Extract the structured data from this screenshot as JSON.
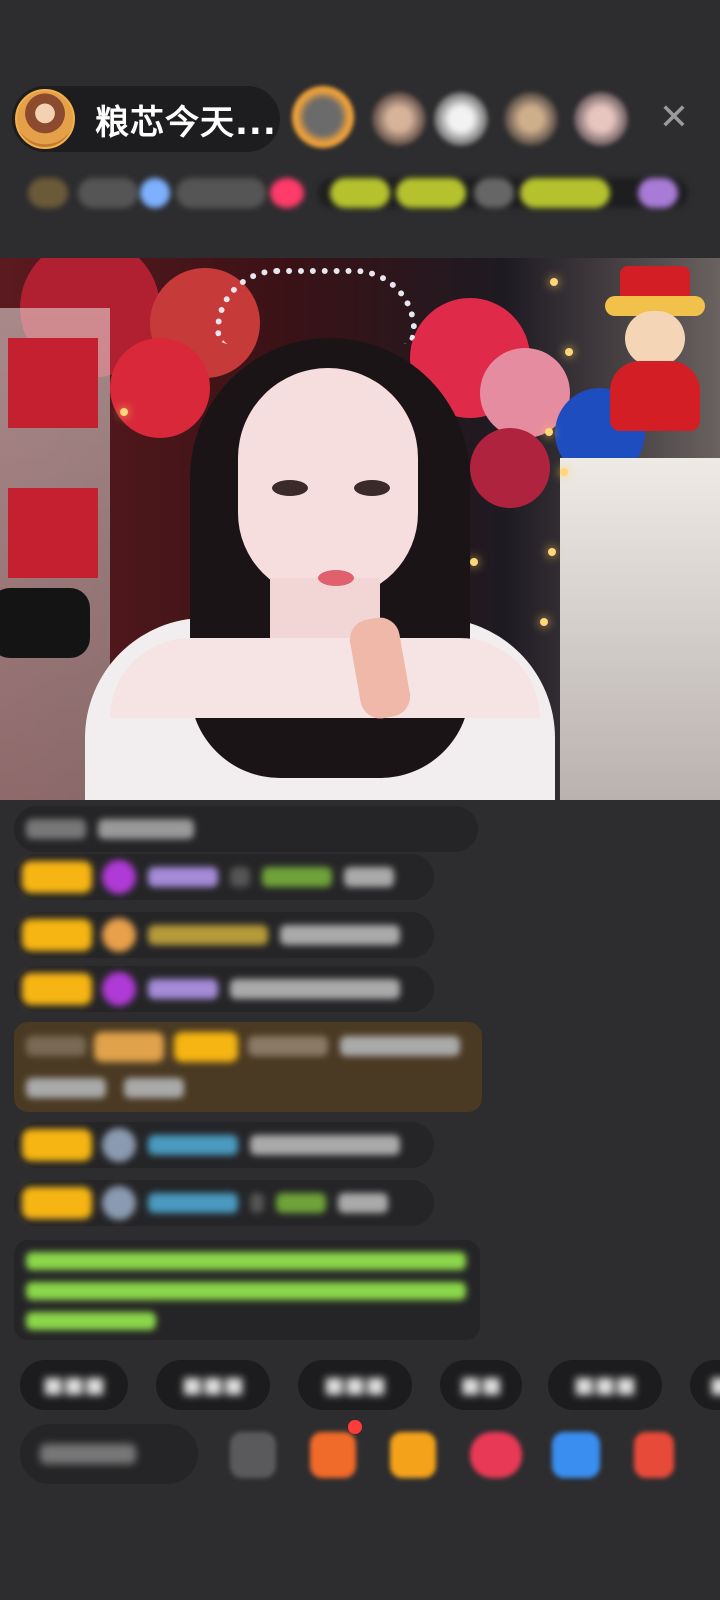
{
  "header": {
    "host_name": "粮芯今天...",
    "close_icon": "close-icon"
  },
  "colors": {
    "background": "#2d2d2f",
    "pill": "#1d1d1f",
    "level_badge": "#f6b512",
    "system_message_text": "#8bd64a"
  }
}
